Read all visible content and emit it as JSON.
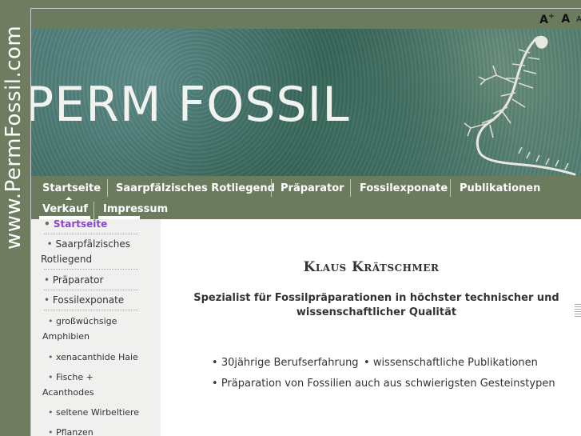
{
  "side_strip": {
    "text": "www.PermFossil.com"
  },
  "font_sizer": {
    "larger": "A",
    "larger_sup": "+",
    "normal": "A",
    "smaller": "A"
  },
  "banner": {
    "title": "PERM FOSSIL"
  },
  "nav": {
    "items": [
      {
        "label": "Startseite",
        "active": true
      },
      {
        "label": "Saarpfälzisches Rotliegend"
      },
      {
        "label": "Präparator"
      },
      {
        "label": "Fossilexponate"
      },
      {
        "label": "Publikationen"
      },
      {
        "label": "Verkauf"
      },
      {
        "label": "Impressum"
      }
    ]
  },
  "sidebar": {
    "items": [
      {
        "label": "Startseite",
        "active": true
      },
      {
        "label": "Saarpfälzisches Rotliegend"
      },
      {
        "label": "Präparator"
      },
      {
        "label": "Fossilexponate"
      },
      {
        "label": "großwüchsige Amphibien"
      },
      {
        "label": "xenacanthide Haie"
      },
      {
        "label": "Fische + Acanthodes"
      },
      {
        "label": "seltene Wirbeltiere"
      },
      {
        "label": "Pflanzen"
      }
    ]
  },
  "main": {
    "headline": "Klaus Krätschmer",
    "subline": "Spezialist für Fossilpräparationen in höchster technischer und wissenschaftlicher Qualität",
    "features": [
      "30jährige Berufserfahrung",
      "wissenschaftliche Publikationen",
      "Präparation von Fossilien auch aus schwierigsten Gesteinstypen"
    ]
  },
  "colors": {
    "nav_bg": "#6b7b5e",
    "active_link": "#8a47c9",
    "sidebar_bg": "#f0f0ee"
  }
}
